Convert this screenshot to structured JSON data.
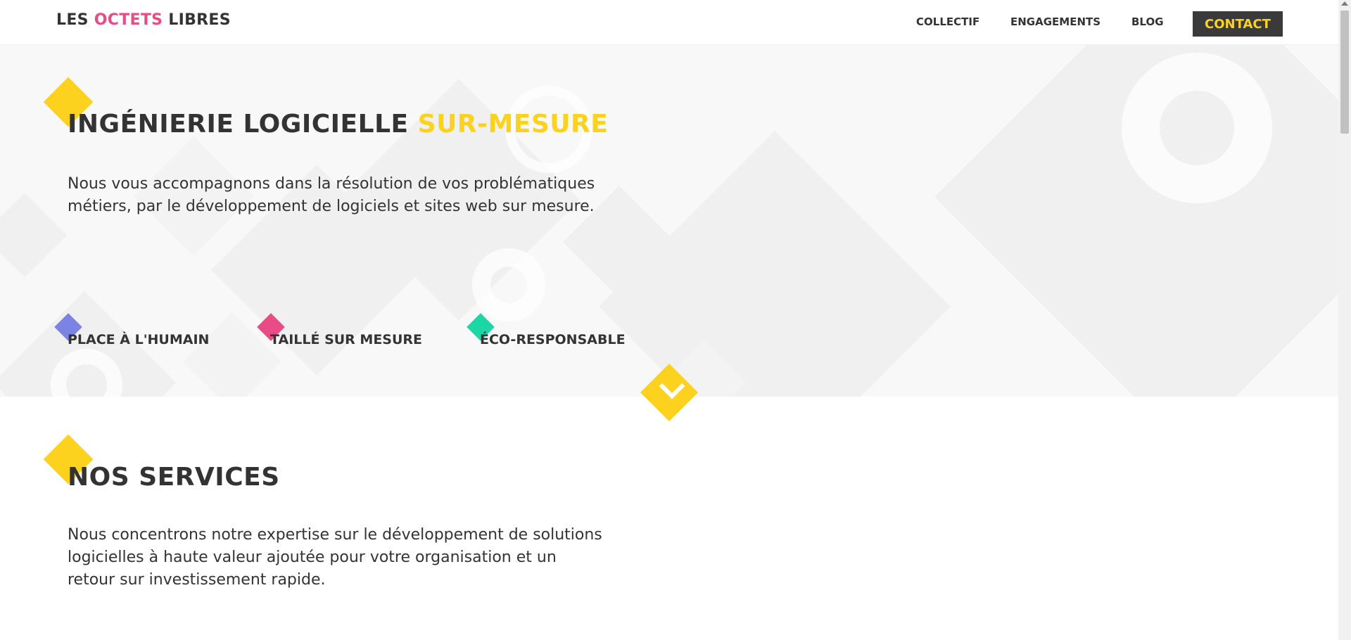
{
  "header": {
    "logo_part1": "LES ",
    "logo_part2": "OCTETS",
    "logo_part3": " LIBRES",
    "nav": {
      "collectif": "COLLECTIF",
      "engagements": "ENGAGEMENTS",
      "blog": "BLOG",
      "contact": "CONTACT"
    }
  },
  "hero": {
    "title_main": "INGÉNIERIE LOGICIELLE ",
    "title_highlight": "SUR-MESURE",
    "description": "Nous vous accompagnons dans la résolution de vos problématiques métiers, par le développement de logiciels et sites web sur mesure.",
    "features": [
      "PLACE À L'HUMAIN",
      "TAILLÉ SUR MESURE",
      "ÉCO-RESPONSABLE"
    ]
  },
  "services": {
    "title": "NOS SERVICES",
    "description": "Nous concentrons notre expertise sur le développement de solutions logicielles à haute valeur ajoutée pour votre organisation et un retour sur investissement rapide."
  },
  "colors": {
    "accent_yellow": "#fcd21f",
    "accent_pink": "#e94b86",
    "feature_blue": "#7b83e3",
    "feature_pink": "#e94b86",
    "feature_green": "#1dd6a5",
    "dark": "#333333",
    "contact_bg": "#3a3a3a"
  },
  "icons": {
    "scroll_down": "chevron-down-icon"
  }
}
